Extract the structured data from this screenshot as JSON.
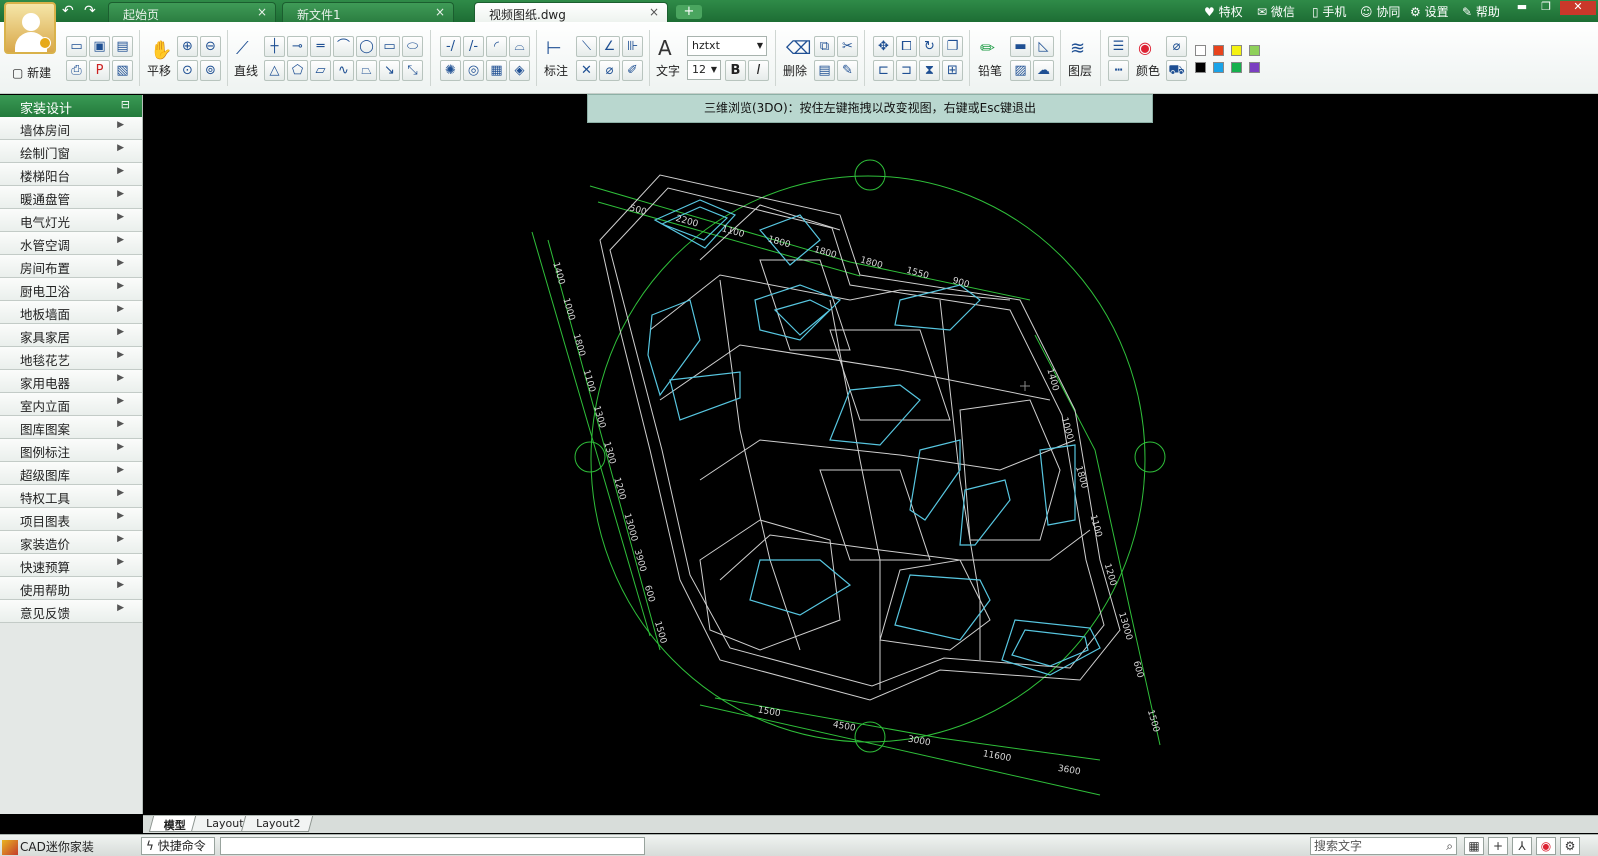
{
  "titlebar": {
    "tabs": [
      {
        "label": "起始页",
        "close": "×",
        "active": false
      },
      {
        "label": "新文件1",
        "close": "×",
        "active": false
      },
      {
        "label": "视频图纸.dwg",
        "close": "×",
        "active": true
      }
    ],
    "add_tab": "+",
    "right_items": [
      "特权",
      "微信",
      "手机",
      "协同",
      "设置",
      "帮助"
    ],
    "icons": {
      "back": "undo-arrow-icon",
      "forward": "redo-arrow-icon"
    }
  },
  "ribbon": {
    "new_label": "新建",
    "pan_label": "平移",
    "line_label": "直线",
    "dimension_label": "标注",
    "text_label": "文字",
    "font_name": "hztxt",
    "font_size": "12",
    "bold": "B",
    "italic": "I",
    "delete_label": "删除",
    "pencil_label": "铅笔",
    "layer_label": "图层",
    "color_label": "颜色",
    "swatches": [
      "#ffffff",
      "#e8431c",
      "#f4f212",
      "#8ed05a",
      "#000000",
      "#1aa3e8",
      "#16b04d",
      "#7b3fc1"
    ]
  },
  "hint": {
    "text": "三维浏览(3DO)：按住左键拖拽以改变视图，右键或Esc键退出"
  },
  "sidebar": {
    "title": "家装设计",
    "pin": "⊟",
    "items": [
      "墙体房间",
      "绘制门窗",
      "楼梯阳台",
      "暖通盘管",
      "电气灯光",
      "水管空调",
      "房间布置",
      "厨电卫浴",
      "地板墙面",
      "家具家居",
      "地毯花艺",
      "家用电器",
      "室内立面",
      "图库图案",
      "图例标注",
      "超级图库",
      "特权工具",
      "项目图表",
      "家装造价",
      "快速预算",
      "使用帮助",
      "意见反馈"
    ]
  },
  "drawing": {
    "dim_top": [
      "500",
      "2200",
      "1100",
      "1800",
      "1800",
      "1800",
      "1550",
      "900"
    ],
    "dim_left": [
      "1400",
      "1000",
      "1800",
      "1100",
      "1300",
      "1300",
      "1200",
      "13000",
      "3900",
      "600",
      "1500"
    ],
    "dim_right": [
      "1400",
      "1000",
      "1800",
      "1100",
      "1200",
      "13000",
      "600",
      "1500"
    ],
    "dim_bottom": [
      "1500",
      "4500",
      "3000",
      "11600",
      "3600"
    ]
  },
  "layout_tabs": [
    "模型",
    "Layout1",
    "Layout2"
  ],
  "status": {
    "app_name": "CAD迷你家装",
    "command_label": "快捷命令",
    "command_value": "",
    "search_placeholder": "搜索文字"
  }
}
